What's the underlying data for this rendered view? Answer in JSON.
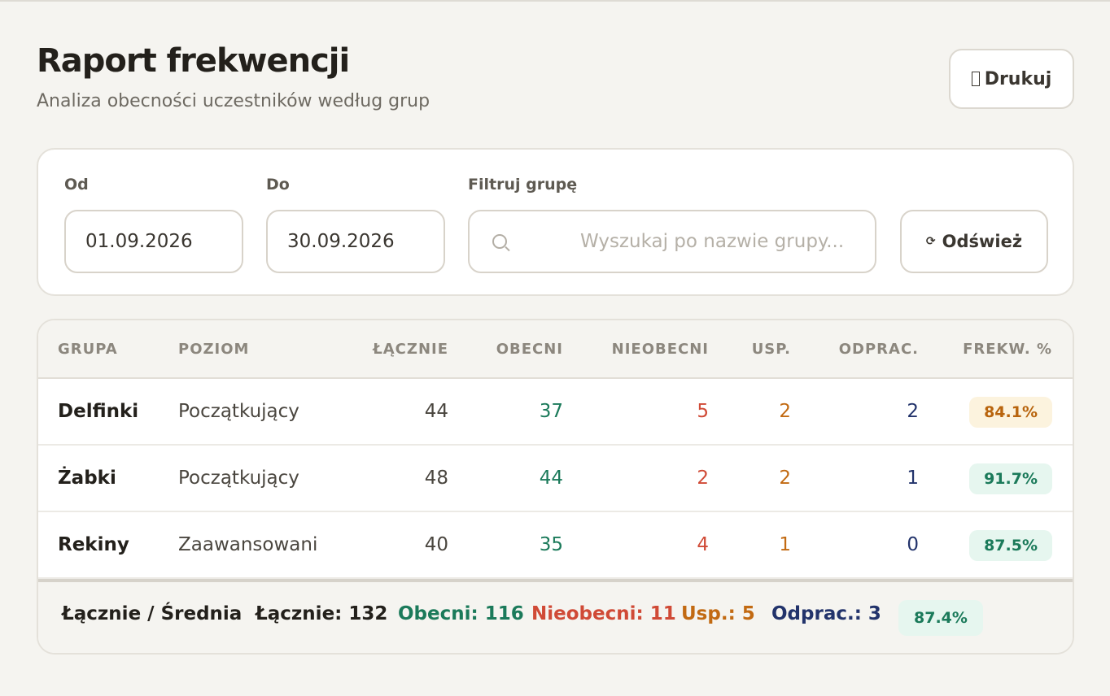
{
  "header": {
    "title": "Raport frekwencji",
    "subtitle": "Analiza obecności uczestników według grup",
    "print_label": "Drukuj",
    "print_icon": "printer-icon"
  },
  "filters": {
    "from_label": "Od",
    "from_value": "01.09.2026",
    "to_label": "Do",
    "to_value": "30.09.2026",
    "group_label": "Filtruj grupę",
    "search_placeholder": "Wyszukaj po nazwie grupy...",
    "search_icon": "search-icon",
    "refresh_label": "Odśwież",
    "refresh_icon": "refresh-icon"
  },
  "table": {
    "columns": [
      "GRUPA",
      "POZIOM",
      "ŁĄCZNIE",
      "OBECNI",
      "NIEOBECNI",
      "USP.",
      "ODPRAC.",
      "FREKW. %"
    ],
    "rows": [
      {
        "group": "Delfinki",
        "level": "Początkujący",
        "total": "44",
        "present": "37",
        "absent": "5",
        "excused": "2",
        "makeup": "2",
        "rate": "84.1%"
      },
      {
        "group": "Żabki",
        "level": "Początkujący",
        "total": "48",
        "present": "44",
        "absent": "2",
        "excused": "2",
        "makeup": "1",
        "rate": "91.7%"
      },
      {
        "group": "Rekiny",
        "level": "Zaawansowani",
        "total": "40",
        "present": "35",
        "absent": "4",
        "excused": "1",
        "makeup": "0",
        "rate": "87.5%"
      }
    ],
    "footer": {
      "label": "Łącznie / Średnia",
      "total": "Łącznie: 132",
      "present": "Obecni: 116",
      "absent": "Nieobecni: 11",
      "excused": "Usp.: 5",
      "makeup": "Odprac.: 3",
      "rate": "87.4%"
    }
  },
  "colors": {
    "present": "#1b7a5a",
    "absent": "#d04a36",
    "excused": "#c26a12",
    "makeup": "#22336b",
    "rate_warning_bg": "#fcf3de",
    "rate_good_bg": "#e6f6ef"
  }
}
